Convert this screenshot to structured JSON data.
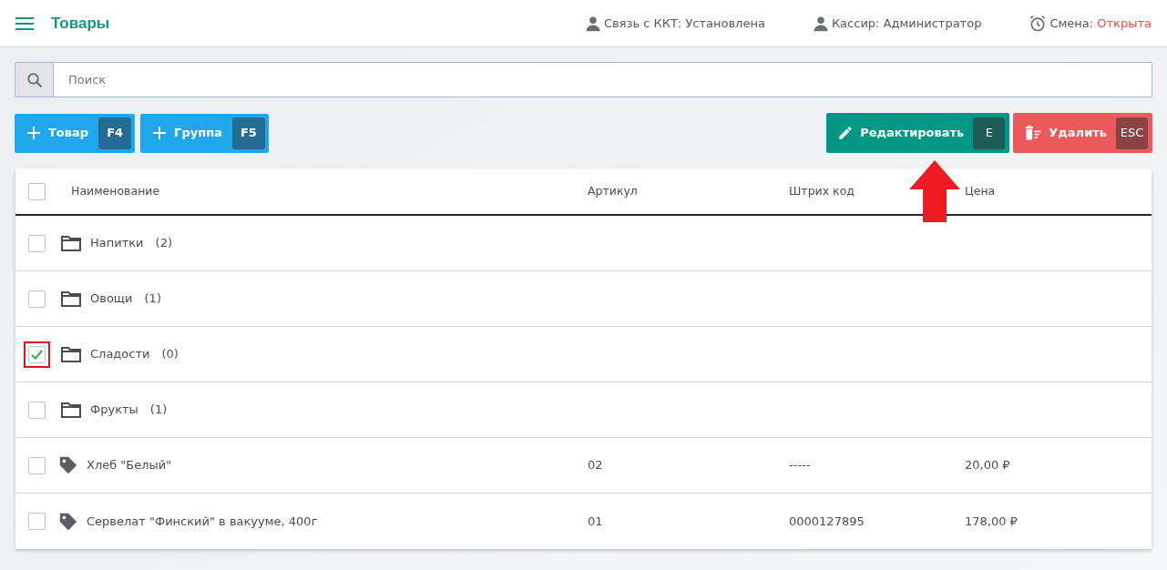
{
  "header": {
    "title": "Товары",
    "status": [
      {
        "kind": "person",
        "label": "Связь с ККТ: Установлена"
      },
      {
        "kind": "person",
        "label": "Кассир: Администратор"
      },
      {
        "kind": "shift",
        "label": "Смена:",
        "value": "Открыта"
      }
    ]
  },
  "search": {
    "placeholder": "Поиск"
  },
  "left_buttons": [
    {
      "label": "Товар",
      "key": "F4"
    },
    {
      "label": "Группа",
      "key": "F5"
    }
  ],
  "right_buttons": [
    {
      "kind": "edit",
      "label": "Редактировать",
      "key": "E"
    },
    {
      "kind": "delete",
      "label": "Удалить",
      "key": "ESC"
    }
  ],
  "table": {
    "select_all": {
      "checked": false
    },
    "columns": [
      "Наименование",
      "Артикул",
      "Штрих код",
      "Цена"
    ],
    "rows": [
      {
        "kind": "group",
        "name": "Напитки",
        "count": "(2)",
        "checked": false,
        "highlighted": false
      },
      {
        "kind": "group",
        "name": "Овощи",
        "count": "(1)",
        "checked": false,
        "highlighted": false
      },
      {
        "kind": "group",
        "name": "Сладости",
        "count": "(0)",
        "checked": true,
        "highlighted": true
      },
      {
        "kind": "group",
        "name": "Фрукты",
        "count": "(1)",
        "checked": false,
        "highlighted": false
      },
      {
        "kind": "product",
        "name": "Хлеб \"Белый\"",
        "article": "02",
        "barcode": "-----",
        "price": "20,00 ₽",
        "checked": false,
        "highlighted": false
      },
      {
        "kind": "product",
        "name": "Сервелат \"Финский\" в вакууме, 400г",
        "article": "01",
        "barcode": "0000127895",
        "price": "178,00 ₽",
        "checked": false,
        "highlighted": false
      }
    ]
  },
  "annotation": {
    "arrow": true
  }
}
